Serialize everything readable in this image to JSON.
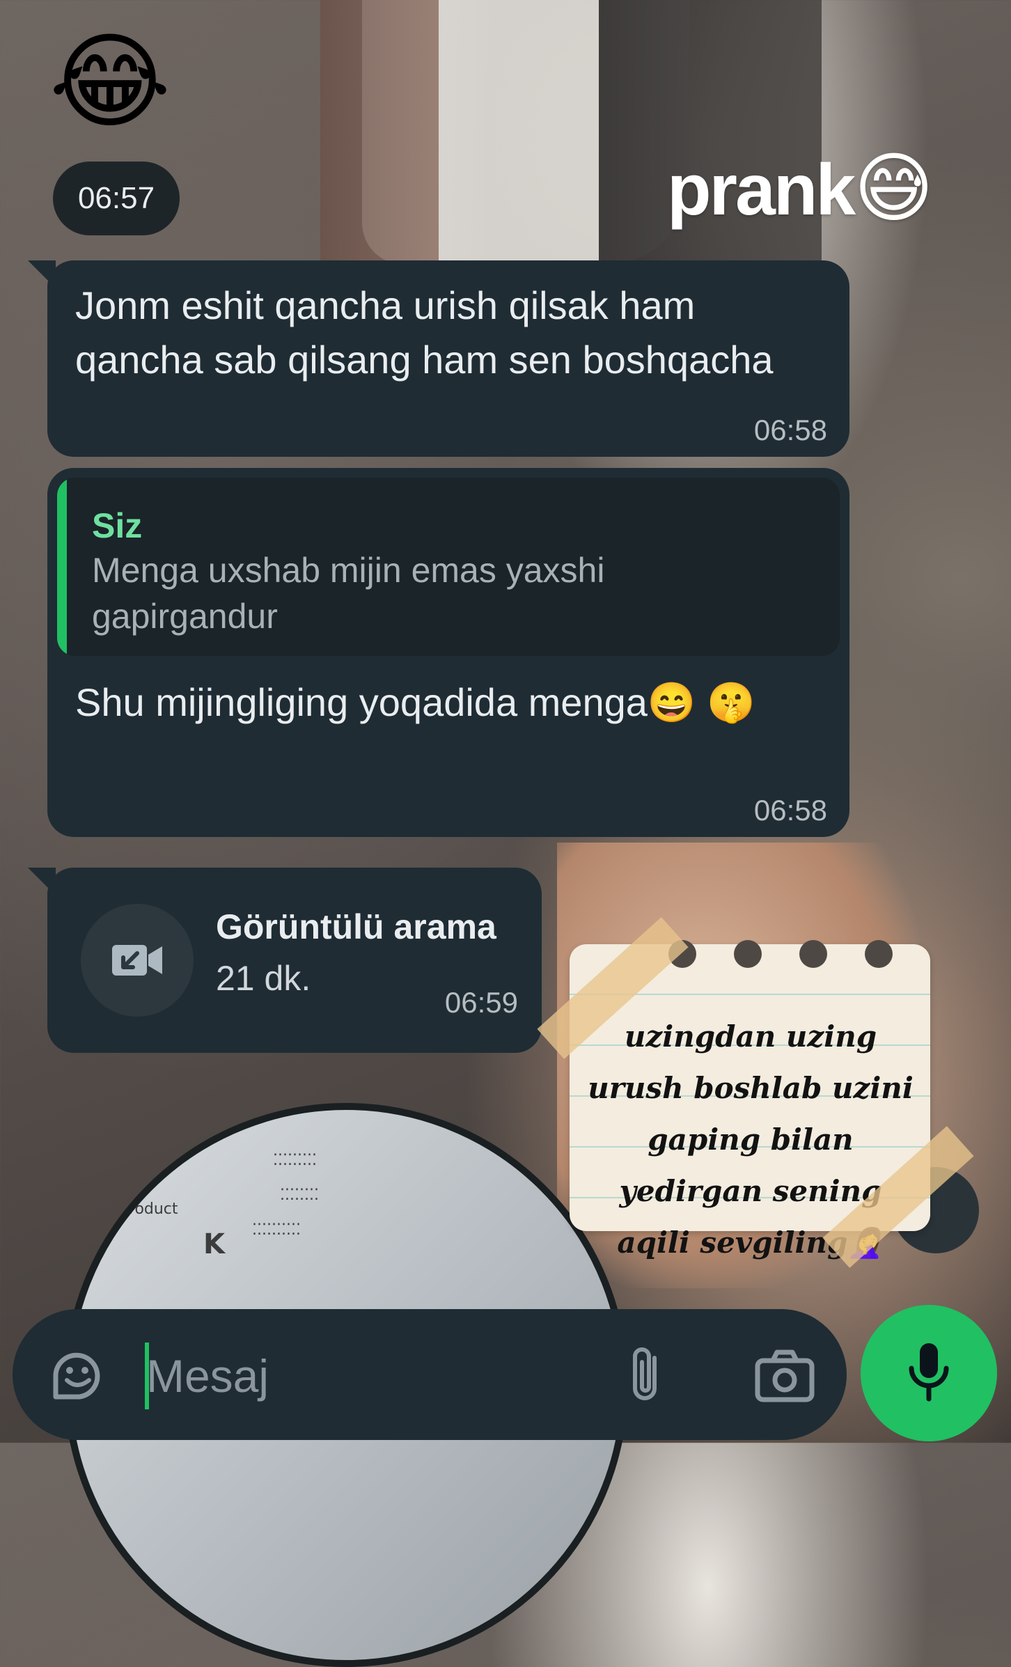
{
  "overlay": {
    "prank_text": "prank",
    "prank_emoji": "😅",
    "top_emoji": "😂"
  },
  "chat": {
    "date_pill": "06:57",
    "messages": [
      {
        "text": "Jonm eshit qancha urish qilsak ham qancha sab qilsang ham sen boshqacha",
        "time": "06:58"
      },
      {
        "quote_author": "Siz",
        "quote_text": "Menga uxshab mijin emas yaxshi gapirgandur",
        "text": "Shu mijingliging yoqadida menga😄 🤫",
        "time": "06:58"
      },
      {
        "call_title": "Görüntülü arama",
        "call_duration": "21 dk.",
        "time": "06:59",
        "icon": "video-call-incoming-icon"
      }
    ]
  },
  "sticky_note": {
    "text": "uzingdan uzing urush boshlab uzini gaping bilan yedirgan sening aqili sevgiling🤦‍♀️"
  },
  "input": {
    "placeholder": "Mesaj",
    "icons": [
      "sticker-icon",
      "attach-icon",
      "camera-icon",
      "mic-icon"
    ]
  },
  "colors": {
    "bubble": "#1f2c34",
    "accent_green": "#21c063",
    "quote_name": "#6fe0a0"
  }
}
